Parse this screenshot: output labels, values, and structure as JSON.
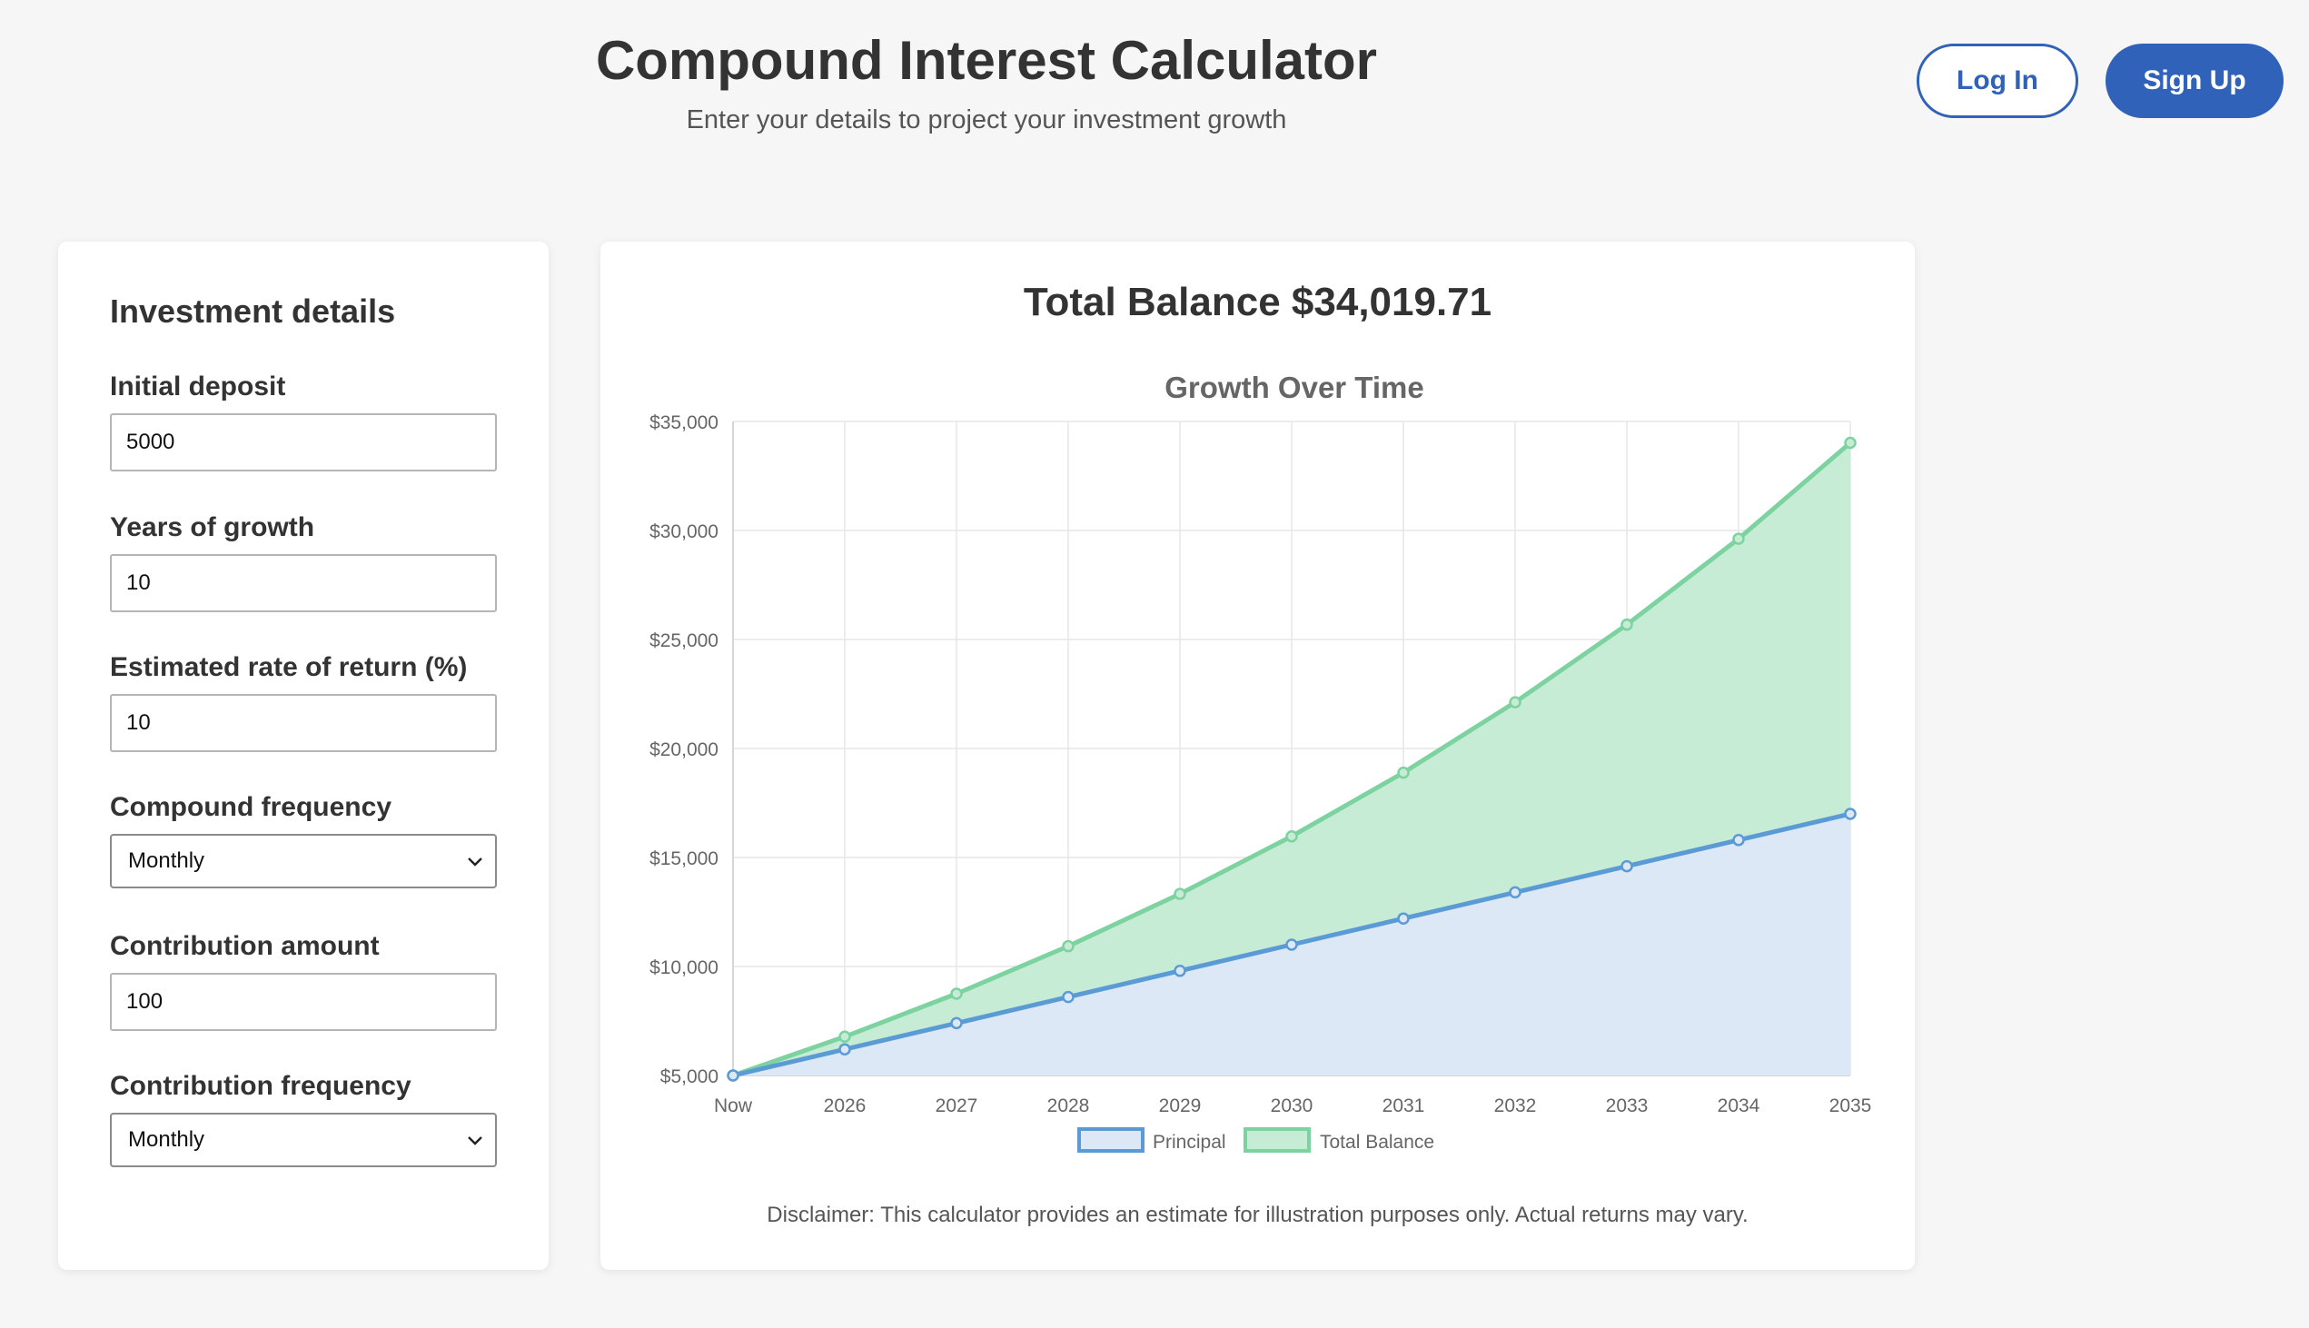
{
  "header": {
    "title": "Compound Interest Calculator",
    "subtitle": "Enter your details to project your investment growth",
    "login_label": "Log In",
    "signup_label": "Sign Up"
  },
  "form": {
    "heading": "Investment details",
    "fields": [
      {
        "label": "Initial deposit",
        "value": "5000"
      },
      {
        "label": "Years of growth",
        "value": "10"
      },
      {
        "label": "Estimated rate of return (%)",
        "value": "10"
      },
      {
        "label": "Compound frequency",
        "value": "Monthly"
      },
      {
        "label": "Contribution amount",
        "value": "100"
      },
      {
        "label": "Contribution frequency",
        "value": "Monthly"
      }
    ]
  },
  "result": {
    "total_balance": "Total Balance $34,019.71",
    "disclaimer": "Disclaimer: This calculator provides an estimate for illustration purposes only. Actual returns may vary."
  },
  "colors": {
    "accent": "#2f62b8",
    "principal": "#5b9bd5",
    "principal_fill": "#dce8f6",
    "total": "#7dd3a0",
    "total_fill": "#c6ecd6"
  },
  "chart_data": {
    "type": "area",
    "title": "Growth Over Time",
    "x": [
      "Now",
      "2026",
      "2027",
      "2028",
      "2029",
      "2030",
      "2031",
      "2032",
      "2033",
      "2034",
      "2035"
    ],
    "series": [
      {
        "name": "Principal",
        "values": [
          5000,
          6200,
          7400,
          8600,
          9800,
          11000,
          12200,
          13400,
          14600,
          15800,
          17000
        ]
      },
      {
        "name": "Total Balance",
        "values": [
          5000,
          6780,
          8750,
          10930,
          13330,
          15970,
          18890,
          22120,
          25680,
          29620,
          34019.71
        ]
      }
    ],
    "ylim": [
      5000,
      35000
    ],
    "yticks": [
      "$5,000",
      "$10,000",
      "$15,000",
      "$20,000",
      "$25,000",
      "$30,000",
      "$35,000"
    ],
    "ytick_values": [
      5000,
      10000,
      15000,
      20000,
      25000,
      30000,
      35000
    ],
    "grid": true,
    "legend": "bottom"
  }
}
